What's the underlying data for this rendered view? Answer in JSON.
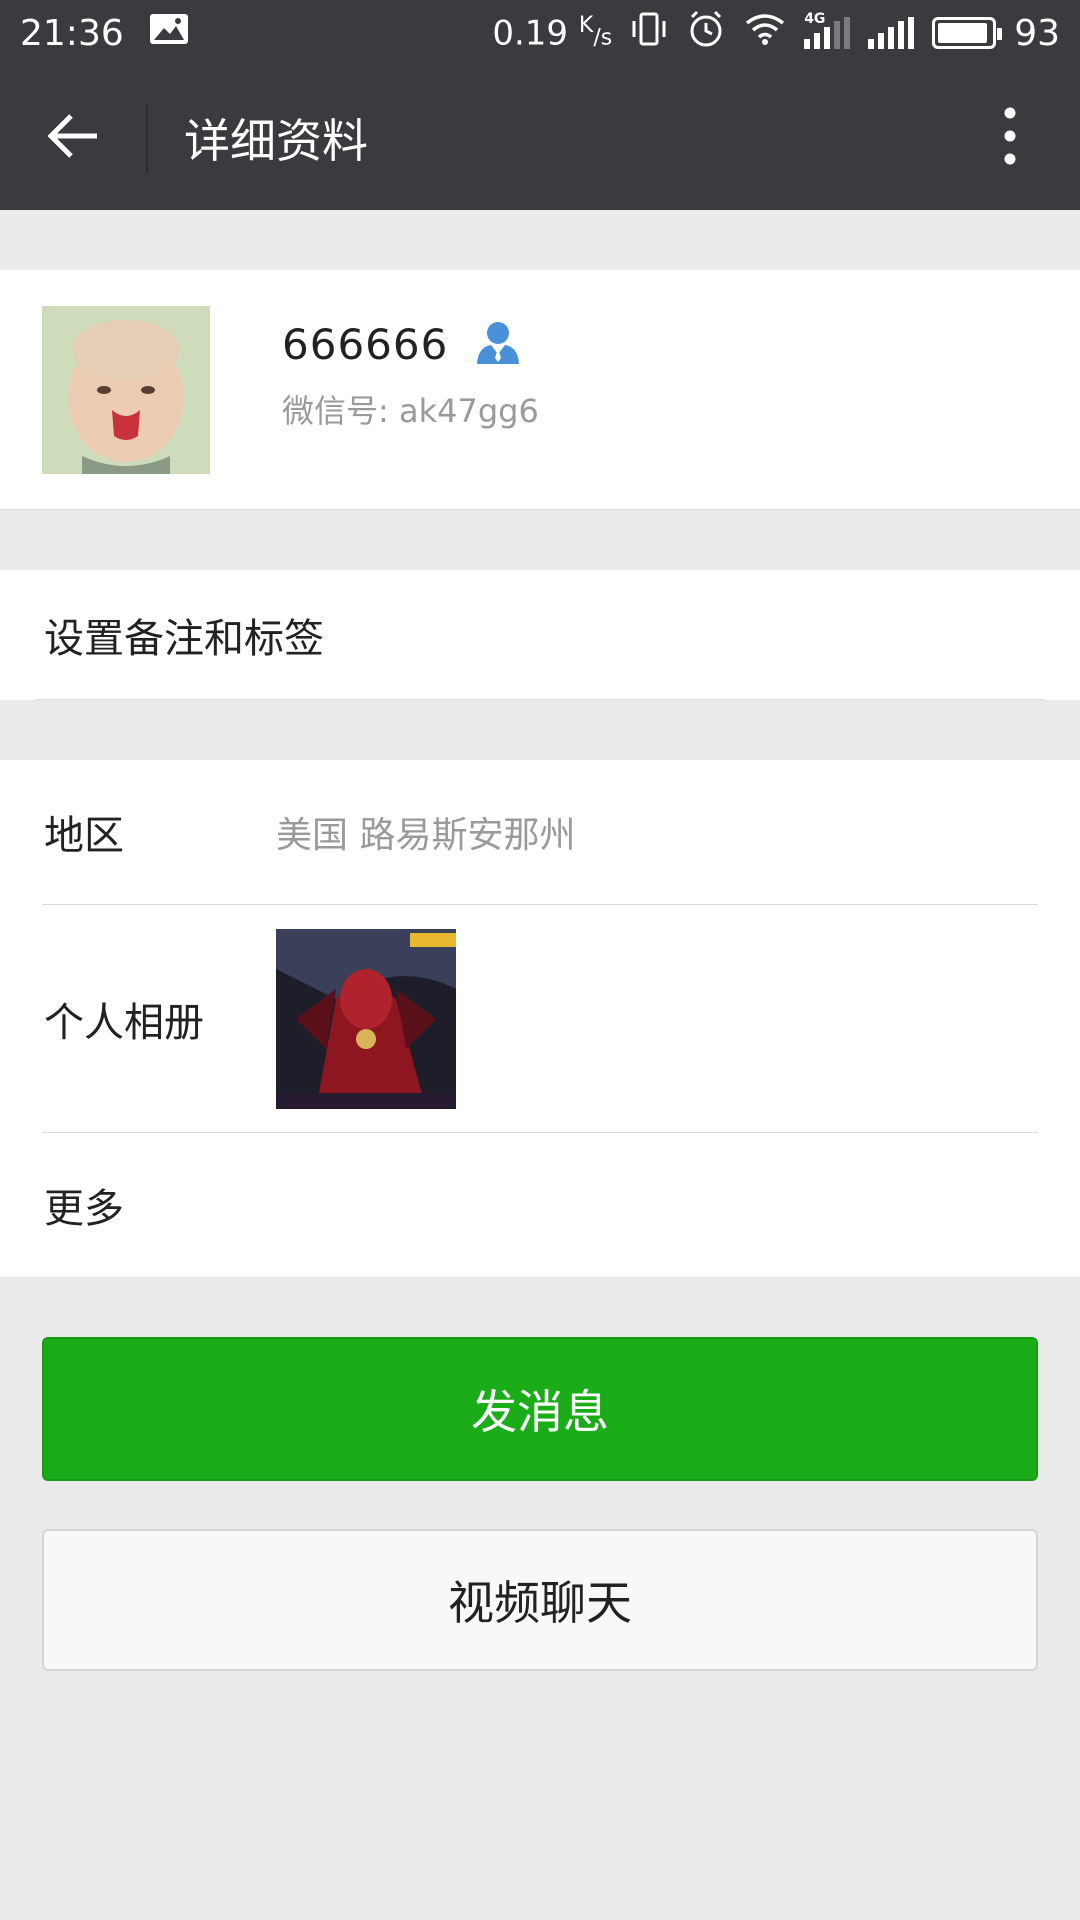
{
  "status_bar": {
    "time": "21:36",
    "net_speed": "0.19",
    "net_unit_top": "K",
    "net_unit_bottom": "/s",
    "network_type": "4G",
    "battery": "93",
    "battery_level": 0.93
  },
  "app_bar": {
    "title": "详细资料",
    "back_icon": "arrow-left-icon",
    "more_icon": "more-vertical-icon"
  },
  "profile": {
    "name": "666666",
    "wechat_id": "微信号: ak47gg6",
    "contact_icon": "user-icon"
  },
  "remark": {
    "label": "设置备注和标签"
  },
  "info": {
    "region_label": "地区",
    "region_value": "美国  路易斯安那州",
    "album_label": "个人相册",
    "more_label": "更多"
  },
  "actions": {
    "send_message": "发消息",
    "video_chat": "视频聊天"
  },
  "colors": {
    "bar_bg": "#3a3b3f",
    "primary_green": "#1aad19",
    "page_bg": "#ebebeb",
    "icon_blue": "#4a90d9"
  }
}
